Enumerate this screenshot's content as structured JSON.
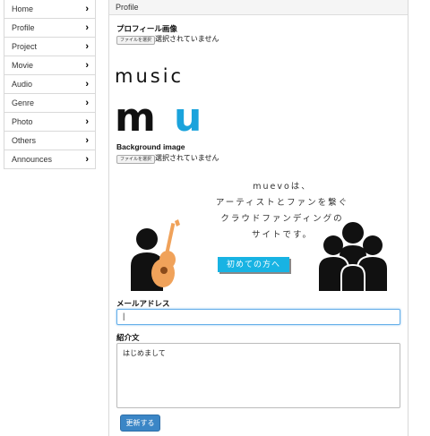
{
  "sidebar": {
    "items": [
      {
        "label": "Home"
      },
      {
        "label": "Profile"
      },
      {
        "label": "Project"
      },
      {
        "label": "Movie"
      },
      {
        "label": "Audio"
      },
      {
        "label": "Genre"
      },
      {
        "label": "Photo"
      },
      {
        "label": "Others"
      },
      {
        "label": "Announces"
      }
    ],
    "chevron": "›"
  },
  "panel": {
    "title": "Profile",
    "profile_image": {
      "label": "プロフィール画像",
      "button": "ファイルを選択",
      "status": "選択されていません"
    },
    "logo": {
      "text": "music",
      "m": "m",
      "u": "u",
      "m_color": "#111111",
      "u_color": "#1aa3dc"
    },
    "background_image": {
      "label": "Background image",
      "button": "ファイルを選択",
      "status": "選択されていません"
    },
    "promo": {
      "lines": [
        "muevoは、",
        "アーティストとファンを繋ぐ",
        "クラウドファンディングの",
        "サイトです。"
      ],
      "cta": "初めての方へ",
      "guitar_color": "#f0a25a"
    },
    "email": {
      "label": "メールアドレス",
      "value": "|"
    },
    "intro": {
      "label": "紹介文",
      "value": "はじめまして"
    },
    "submit": "更新する"
  }
}
